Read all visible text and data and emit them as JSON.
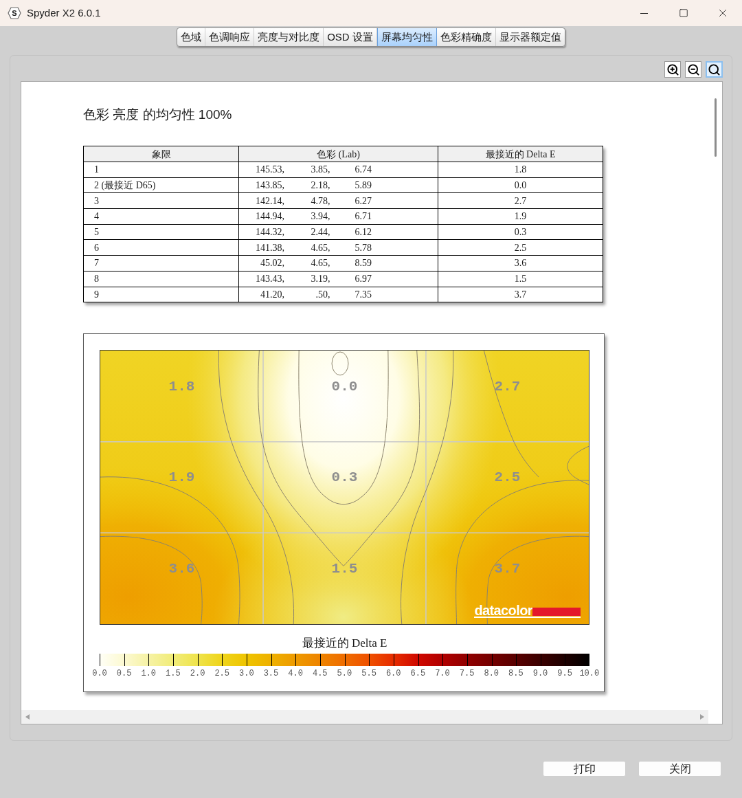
{
  "window": {
    "icon_letter": "S",
    "title": "Spyder X2 6.0.1"
  },
  "tabs": [
    {
      "label": "色域",
      "selected": false
    },
    {
      "label": "色调响应",
      "selected": false
    },
    {
      "label": "亮度与对比度",
      "selected": false
    },
    {
      "label": "OSD 设置",
      "selected": false
    },
    {
      "label": "屏幕均匀性",
      "selected": true
    },
    {
      "label": "色彩精确度",
      "selected": false
    },
    {
      "label": "显示器额定值",
      "selected": false
    }
  ],
  "zoom_tools": [
    {
      "kind": "zoom-in",
      "selected": false
    },
    {
      "kind": "zoom-out",
      "selected": false
    },
    {
      "kind": "fit",
      "selected": true
    }
  ],
  "report": {
    "heading": "色彩 亮度 的均匀性 100%",
    "table": {
      "columns": [
        "象限",
        "色彩 (Lab)",
        "最接近的 Delta E"
      ],
      "rows": [
        {
          "quadrant": "1",
          "lab": [
            "145.53,",
            "3.85,",
            "6.74"
          ],
          "delta_e": "1.8"
        },
        {
          "quadrant": "2 (最接近 D65)",
          "lab": [
            "143.85,",
            "2.18,",
            "5.89"
          ],
          "delta_e": "0.0"
        },
        {
          "quadrant": "3",
          "lab": [
            "142.14,",
            "4.78,",
            "6.27"
          ],
          "delta_e": "2.7"
        },
        {
          "quadrant": "4",
          "lab": [
            "144.94,",
            "3.94,",
            "6.71"
          ],
          "delta_e": "1.9"
        },
        {
          "quadrant": "5",
          "lab": [
            "144.32,",
            "2.44,",
            "6.12"
          ],
          "delta_e": "0.3"
        },
        {
          "quadrant": "6",
          "lab": [
            "141.38,",
            "4.65,",
            "5.78"
          ],
          "delta_e": "2.5"
        },
        {
          "quadrant": "7",
          "lab": [
            "45.02,",
            "4.65,",
            "8.59"
          ],
          "delta_e": "3.6"
        },
        {
          "quadrant": "8",
          "lab": [
            "143.43,",
            "3.19,",
            "6.97"
          ],
          "delta_e": "1.5"
        },
        {
          "quadrant": "9",
          "lab": [
            "41.20,",
            ".50,",
            "7.35"
          ],
          "delta_e": "3.7"
        }
      ]
    },
    "uniformity_map": {
      "cells": [
        "1.8",
        "0.0",
        "2.7",
        "1.9",
        "0.3",
        "2.5",
        "3.6",
        "1.5",
        "3.7"
      ],
      "logo": "datacolor",
      "legend": {
        "title": "最接近的 Delta E",
        "ticks": [
          "0.0",
          "0.5",
          "1.0",
          "1.5",
          "2.0",
          "2.5",
          "3.0",
          "3.5",
          "4.0",
          "4.5",
          "5.0",
          "5.5",
          "6.0",
          "6.5",
          "7.0",
          "7.5",
          "8.0",
          "8.5",
          "9.0",
          "9.5",
          "10.0"
        ]
      }
    }
  },
  "buttons": [
    "打印",
    "关闭"
  ]
}
